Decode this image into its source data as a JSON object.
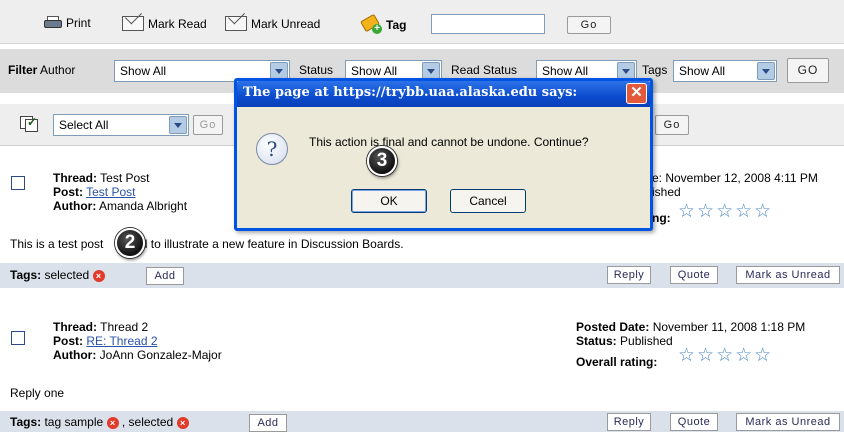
{
  "toolbar": {
    "print": "Print",
    "mark_read": "Mark Read",
    "mark_unread": "Mark Unread",
    "tag": "Tag",
    "tag_value": "",
    "go": "Go"
  },
  "filter": {
    "label": "Filter",
    "author_label": "Author",
    "author_value": "Show All",
    "status_label": "Status",
    "status_value": "Show All",
    "read_status_label": "Read Status",
    "read_status_value": "Show All",
    "tags_label": "Tags",
    "tags_value": "Show All",
    "go": "GO"
  },
  "select_bar": {
    "select_value": "Select All",
    "go": "Go",
    "go_right": "Go"
  },
  "posts": [
    {
      "thread_label": "Thread:",
      "thread": "Test Post",
      "post_label": "Post:",
      "post": "Test Post",
      "author_label": "Author:",
      "author": "Amanda Albright",
      "date_label": "Posted Date:",
      "date": "November 12, 2008 4:11 PM",
      "date_visible": "e: November 12, 2008 4:11 PM",
      "status_visible": "ished",
      "rating_visible": "ng:",
      "body": "This is a test post that is used to illustrate a new feature in Discussion Boards.",
      "body_a": "This is a test post",
      "body_b": "used to illustrate a new feature in Discussion Boards.",
      "tags_label": "Tags:",
      "tags": "selected",
      "add": "Add",
      "reply": "Reply",
      "quote": "Quote",
      "mark_unread": "Mark as Unread"
    },
    {
      "thread_label": "Thread:",
      "thread": "Thread 2",
      "post_label": "Post:",
      "post": "RE: Thread 2",
      "author_label": "Author:",
      "author": "JoAnn Gonzalez-Major",
      "date_label": "Posted Date:",
      "date": "November 11, 2008 1:18 PM",
      "status_label": "Status:",
      "status": "Published",
      "rating_label": "Overall rating:",
      "body": "Reply one",
      "tags_label": "Tags:",
      "tag1": "tag sample",
      "tag2": "selected",
      "add": "Add",
      "reply": "Reply",
      "quote": "Quote",
      "mark_unread": "Mark as Unread"
    }
  ],
  "dialog": {
    "title": "The page at https://trybb.uaa.alaska.edu says:",
    "message": "This action is final and cannot be undone. Continue?",
    "ok": "OK",
    "cancel": "Cancel"
  },
  "markers": {
    "step2": "2",
    "step3": "3"
  },
  "colors": {
    "dialog_title": "#0a4ccd",
    "tags_bar": "#dbe1ea",
    "star": "#4f88c6",
    "delete_icon": "#e03b2b"
  }
}
